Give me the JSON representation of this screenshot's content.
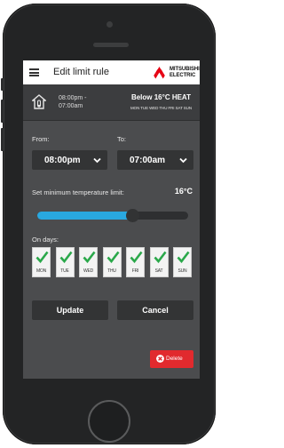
{
  "header": {
    "title": "Edit limit rule",
    "brand_line1": "MITSUBISHI",
    "brand_line2": "ELECTRIC"
  },
  "summary": {
    "start": "08:00pm -",
    "end": "07:00am",
    "mode": "Below 16°C HEAT",
    "days": "MON TUE WED THU FRI SAT SUN"
  },
  "from": {
    "label": "From:",
    "value": "08:00pm"
  },
  "to": {
    "label": "To:",
    "value": "07:00am"
  },
  "temperature": {
    "label": "Set minimum temperature limit:",
    "value": "16°C",
    "slider_level": 0.63
  },
  "days": {
    "label": "On days:",
    "items": [
      {
        "label": "MON",
        "checked": true
      },
      {
        "label": "TUE",
        "checked": true
      },
      {
        "label": "WED",
        "checked": true
      },
      {
        "label": "THU",
        "checked": true
      },
      {
        "label": "FRI",
        "checked": true
      },
      {
        "label": "SAT",
        "checked": true
      },
      {
        "label": "SUN",
        "checked": true
      }
    ]
  },
  "buttons": {
    "update": "Update",
    "cancel": "Cancel",
    "delete": "Delete"
  },
  "colors": {
    "accent": "#29a8e0",
    "check": "#2aa84a",
    "danger": "#e12a2e",
    "screen_bg": "#4b4c4e"
  }
}
